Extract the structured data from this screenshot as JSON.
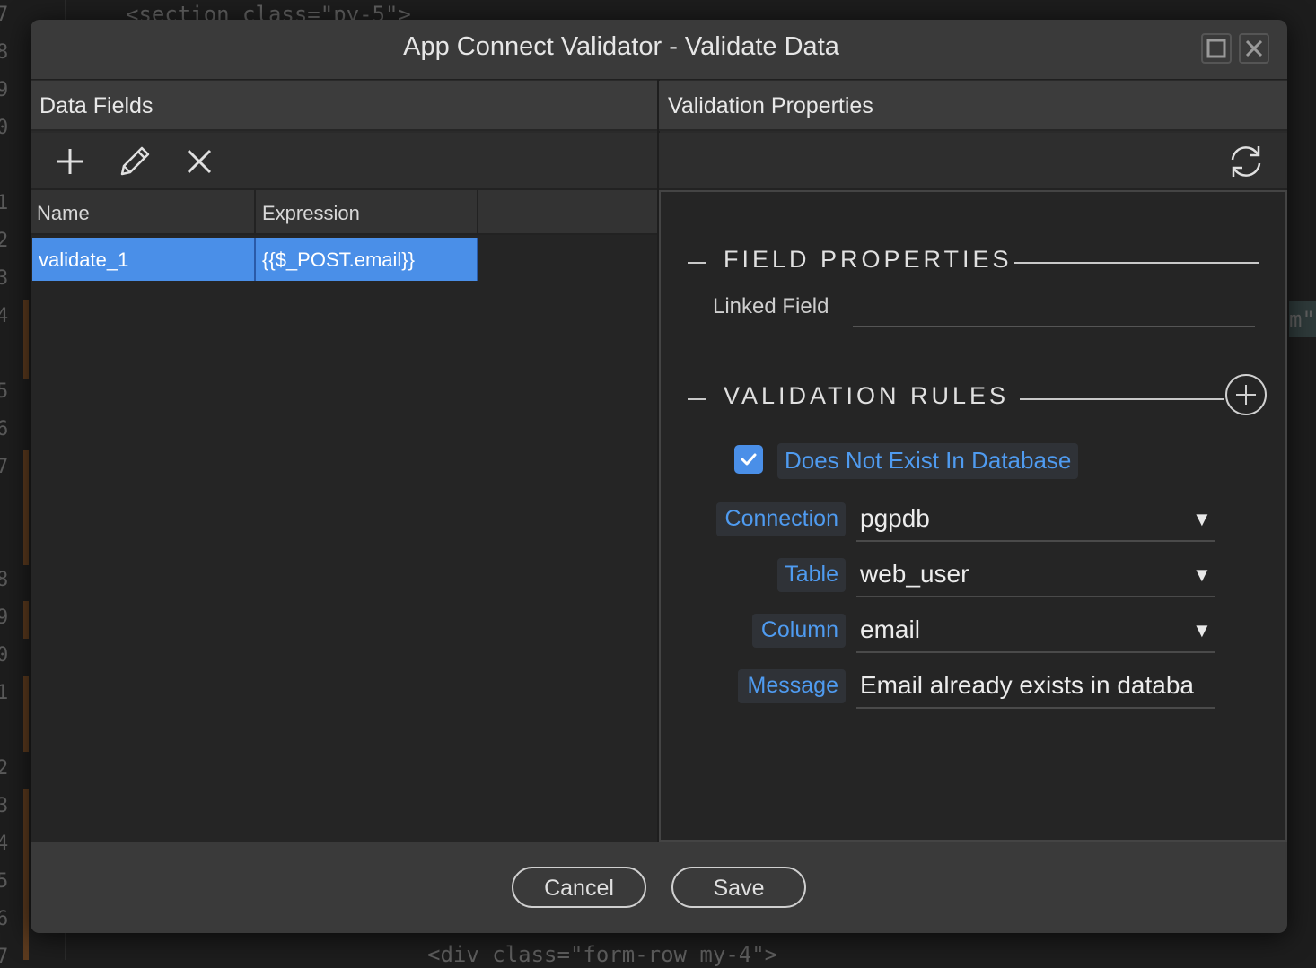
{
  "editor": {
    "line_numbers": [
      "7",
      "8",
      "9",
      "0",
      "1",
      "2",
      "3",
      "4",
      "5",
      "6",
      "7",
      "8",
      "9",
      "0",
      "1",
      "2",
      "3",
      "4",
      "5",
      "6",
      "7"
    ],
    "top_code": "<section class=\"py-5\">",
    "bottom_code": "<div class=\"form-row my-4\">",
    "side_fragment": "m\""
  },
  "dialog": {
    "title": "App Connect Validator - Validate Data"
  },
  "left": {
    "header": "Data Fields",
    "columns": [
      "Name",
      "Expression"
    ],
    "rows": [
      {
        "name": "validate_1",
        "expression": "{{$_POST.email}}"
      }
    ]
  },
  "right": {
    "header": "Validation Properties",
    "field_properties_title": "FIELD PROPERTIES",
    "linked_field_label": "Linked Field",
    "linked_field_value": "",
    "validation_rules_title": "VALIDATION RULES",
    "rule": {
      "checked": true,
      "label": "Does Not Exist In Database"
    },
    "fields": {
      "connection": {
        "label": "Connection",
        "value": "pgpdb"
      },
      "table": {
        "label": "Table",
        "value": "web_user"
      },
      "column": {
        "label": "Column",
        "value": "email"
      },
      "message": {
        "label": "Message",
        "value": "Email already exists in databa"
      }
    }
  },
  "footer": {
    "cancel_label": "Cancel",
    "save_label": "Save"
  },
  "colors": {
    "accent": "#4a8fe8",
    "label_blue": "#4f9bf0"
  },
  "icons": [
    "add-icon",
    "edit-pencil-icon",
    "delete-x-icon",
    "refresh-icon",
    "maximize-icon",
    "close-icon",
    "add-circle-icon",
    "check-icon",
    "dropdown-caret-icon"
  ]
}
